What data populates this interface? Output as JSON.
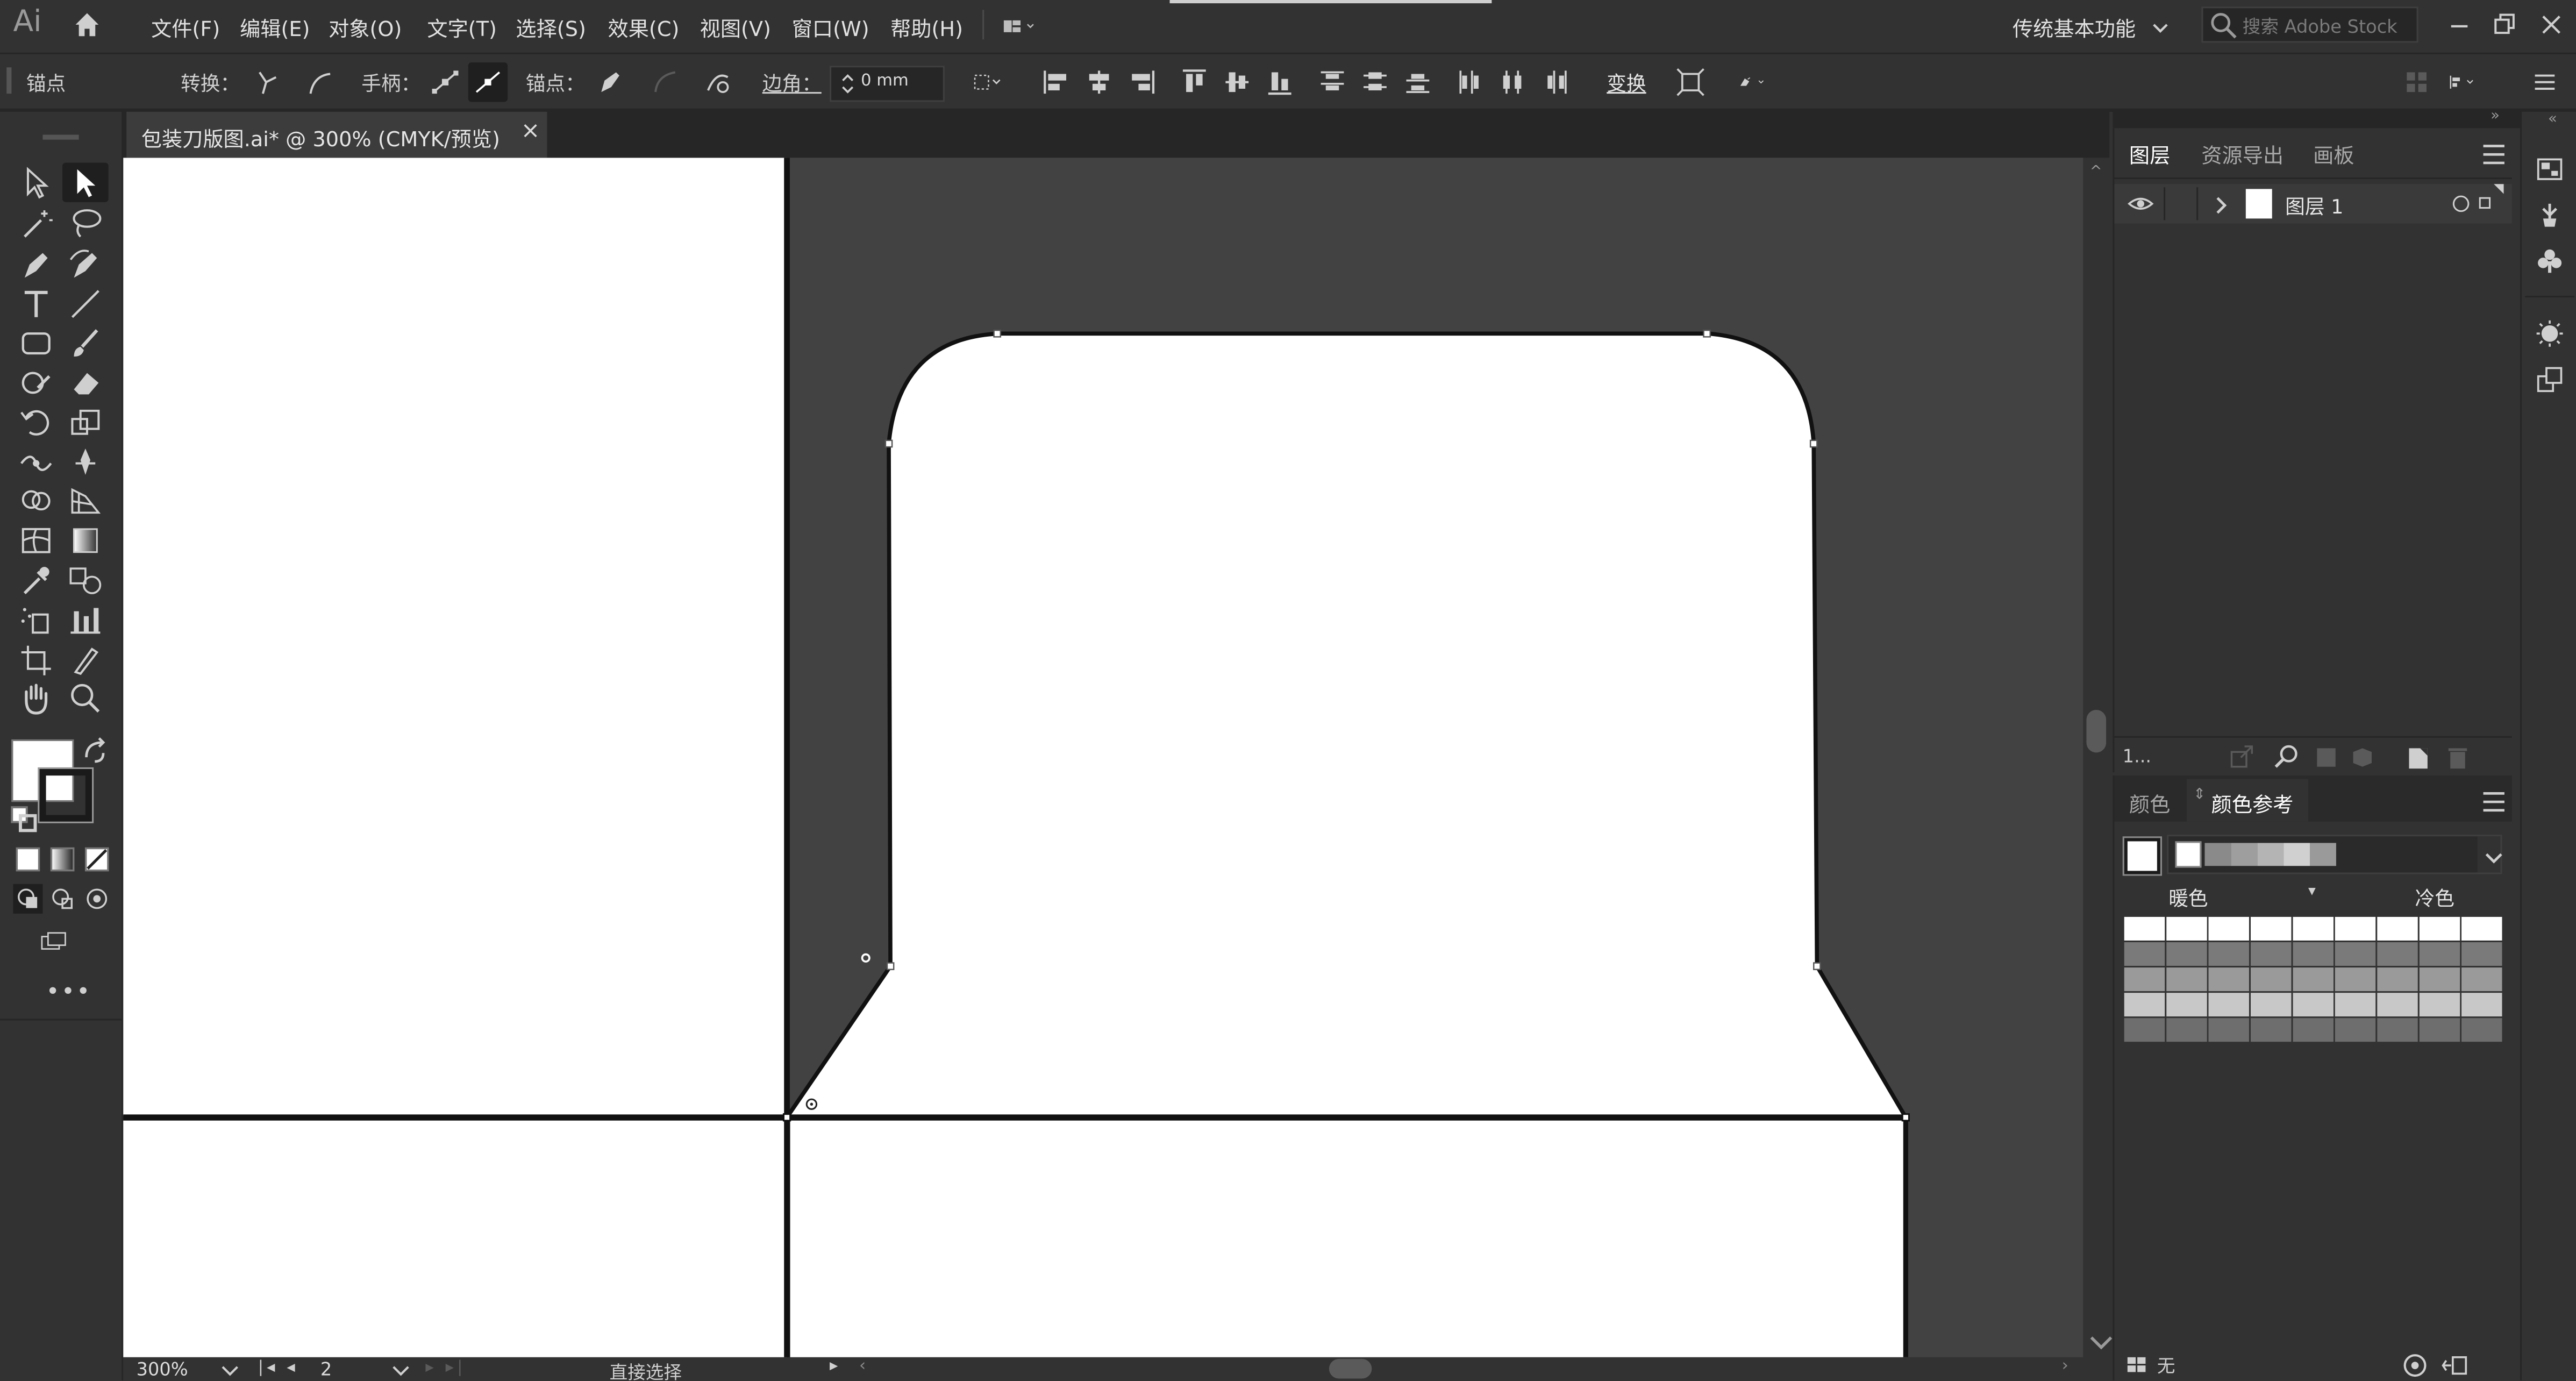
{
  "app": {
    "logo": "Ai"
  },
  "menu": {
    "items": [
      "文件(F)",
      "编辑(E)",
      "对象(O)",
      "文字(T)",
      "选择(S)",
      "效果(C)",
      "视图(V)",
      "窗口(W)",
      "帮助(H)"
    ],
    "workspace": "传统基本功能",
    "search_placeholder": "搜索 Adobe Stock"
  },
  "control_bar": {
    "selection_label": "锚点",
    "convert_label": "转换：",
    "handles_label": "手柄：",
    "anchors_label": "锚点：",
    "corner_label": "边角：",
    "corner_value": "0 mm",
    "transform_label": "变换"
  },
  "document": {
    "tab_title": "包装刀版图.ai* @ 300% (CMYK/预览)",
    "close_glyph": "×"
  },
  "status": {
    "zoom": "300%",
    "artboard_number": "2",
    "tool_name": "直接选择"
  },
  "layers_panel": {
    "tabs": [
      "图层",
      "资源导出",
      "画板"
    ],
    "layers": [
      {
        "name": "图层 1"
      }
    ],
    "layer_count": "1..."
  },
  "color_panel": {
    "tabs": [
      "颜色",
      "颜色参考"
    ],
    "warm_label": "暖色",
    "cool_label": "冷色",
    "footer_label": "无"
  },
  "colors": {
    "ui_bg": "#323232",
    "canvas_bg": "#424242",
    "artboard": "#ffffff",
    "text": "#e2e2e2"
  }
}
